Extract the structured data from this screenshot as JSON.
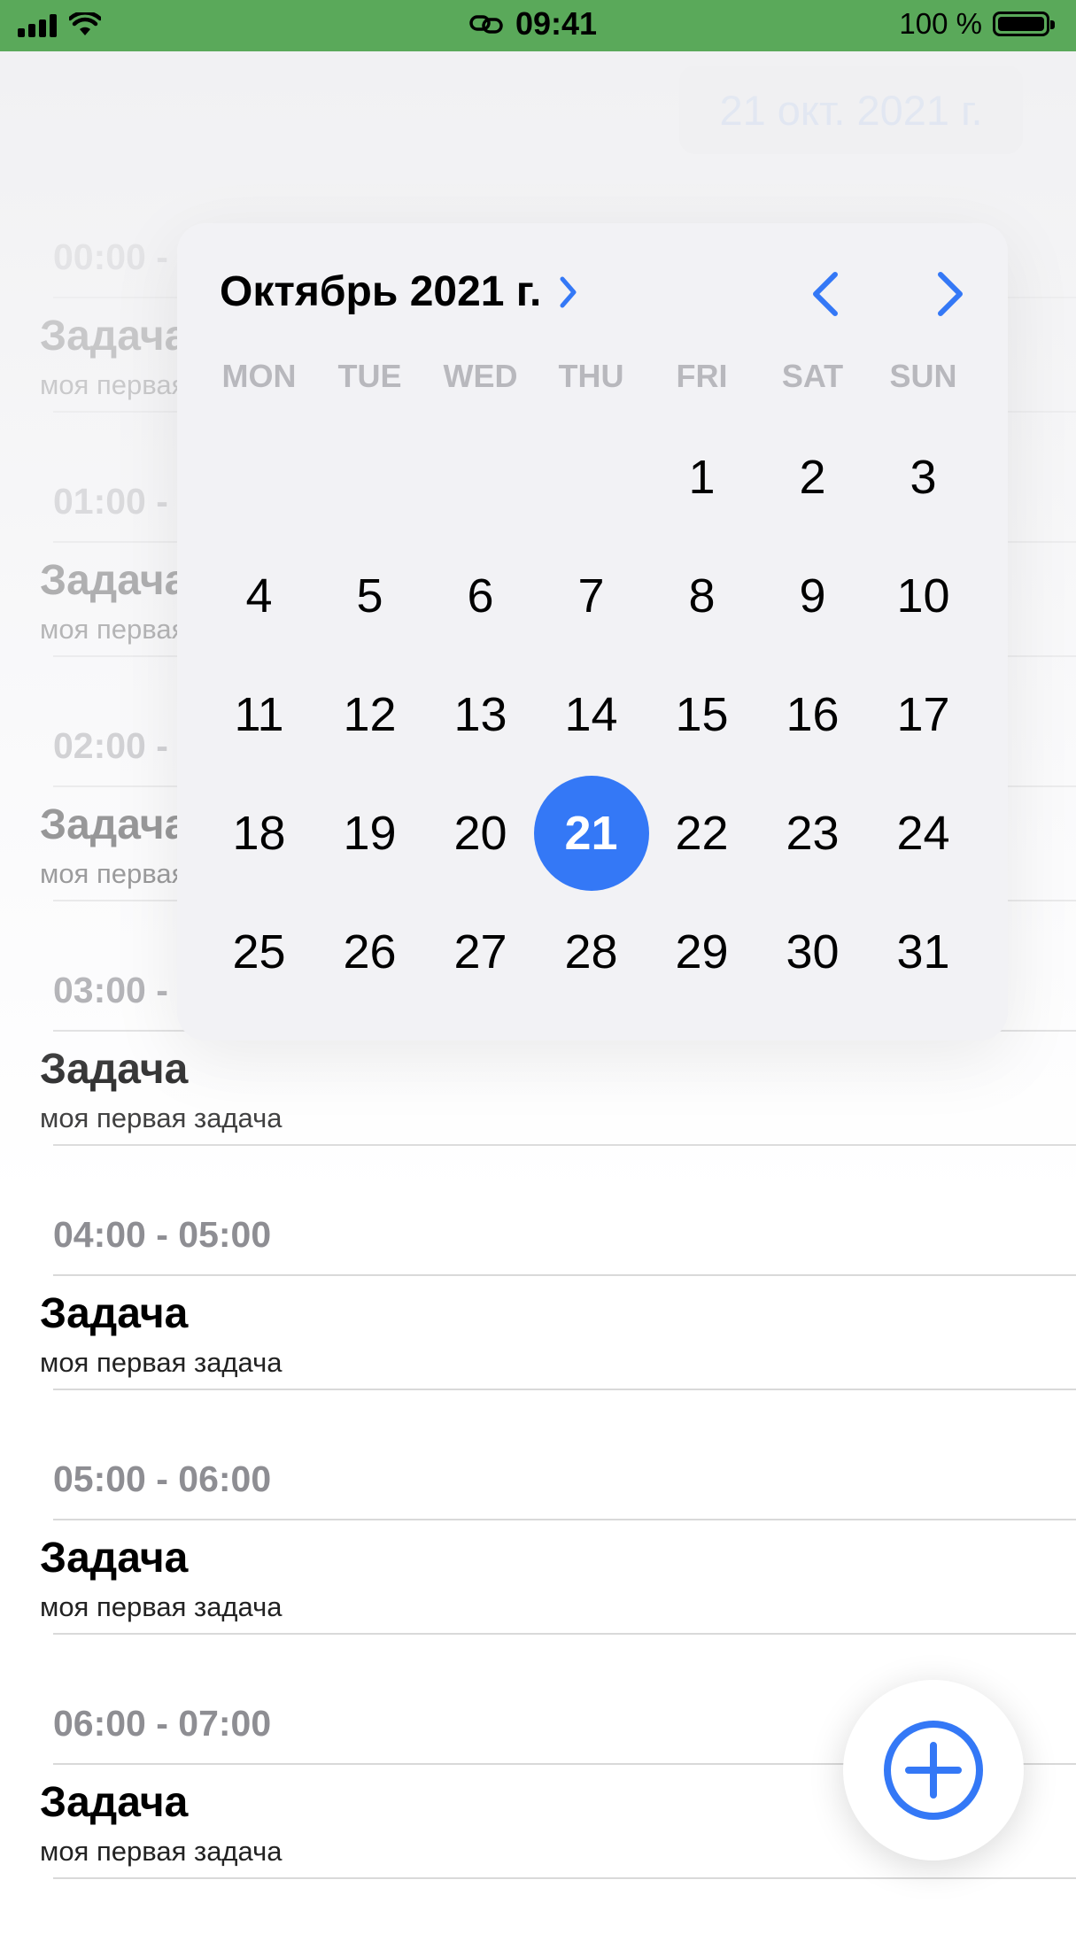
{
  "status_bar": {
    "time": "09:41",
    "battery_text": "100 %"
  },
  "date_button": {
    "label": "21 окт. 2021 г."
  },
  "calendar": {
    "month_label": "Октябрь 2021 г.",
    "weekdays": [
      "MON",
      "TUE",
      "WED",
      "THU",
      "FRI",
      "SAT",
      "SUN"
    ],
    "days": [
      "",
      "",
      "",
      "",
      "1",
      "2",
      "3",
      "4",
      "5",
      "6",
      "7",
      "8",
      "9",
      "10",
      "11",
      "12",
      "13",
      "14",
      "15",
      "16",
      "17",
      "18",
      "19",
      "20",
      "21",
      "22",
      "23",
      "24",
      "25",
      "26",
      "27",
      "28",
      "29",
      "30",
      "31"
    ],
    "selected_day": "21"
  },
  "slots": [
    {
      "time": "00:00 - 01:00",
      "title": "Задача",
      "subtitle": "моя первая задача"
    },
    {
      "time": "01:00 - 02:00",
      "title": "Задача",
      "subtitle": "моя первая задача"
    },
    {
      "time": "02:00 - 03:00",
      "title": "Задача",
      "subtitle": "моя первая задача"
    },
    {
      "time": "03:00 - 04:00",
      "title": "Задача",
      "subtitle": "моя первая задача"
    },
    {
      "time": "04:00 - 05:00",
      "title": "Задача",
      "subtitle": "моя первая задача"
    },
    {
      "time": "05:00 - 06:00",
      "title": "Задача",
      "subtitle": "моя первая задача"
    },
    {
      "time": "06:00 - 07:00",
      "title": "Задача",
      "subtitle": "моя первая задача"
    }
  ],
  "colors": {
    "accent": "#3478f6",
    "status_bar": "#5aa95a"
  },
  "icons": [
    "signal-icon",
    "wifi-icon",
    "link-icon",
    "battery-icon",
    "chevron-right-icon",
    "chevron-left-icon",
    "plus-circle-icon"
  ]
}
